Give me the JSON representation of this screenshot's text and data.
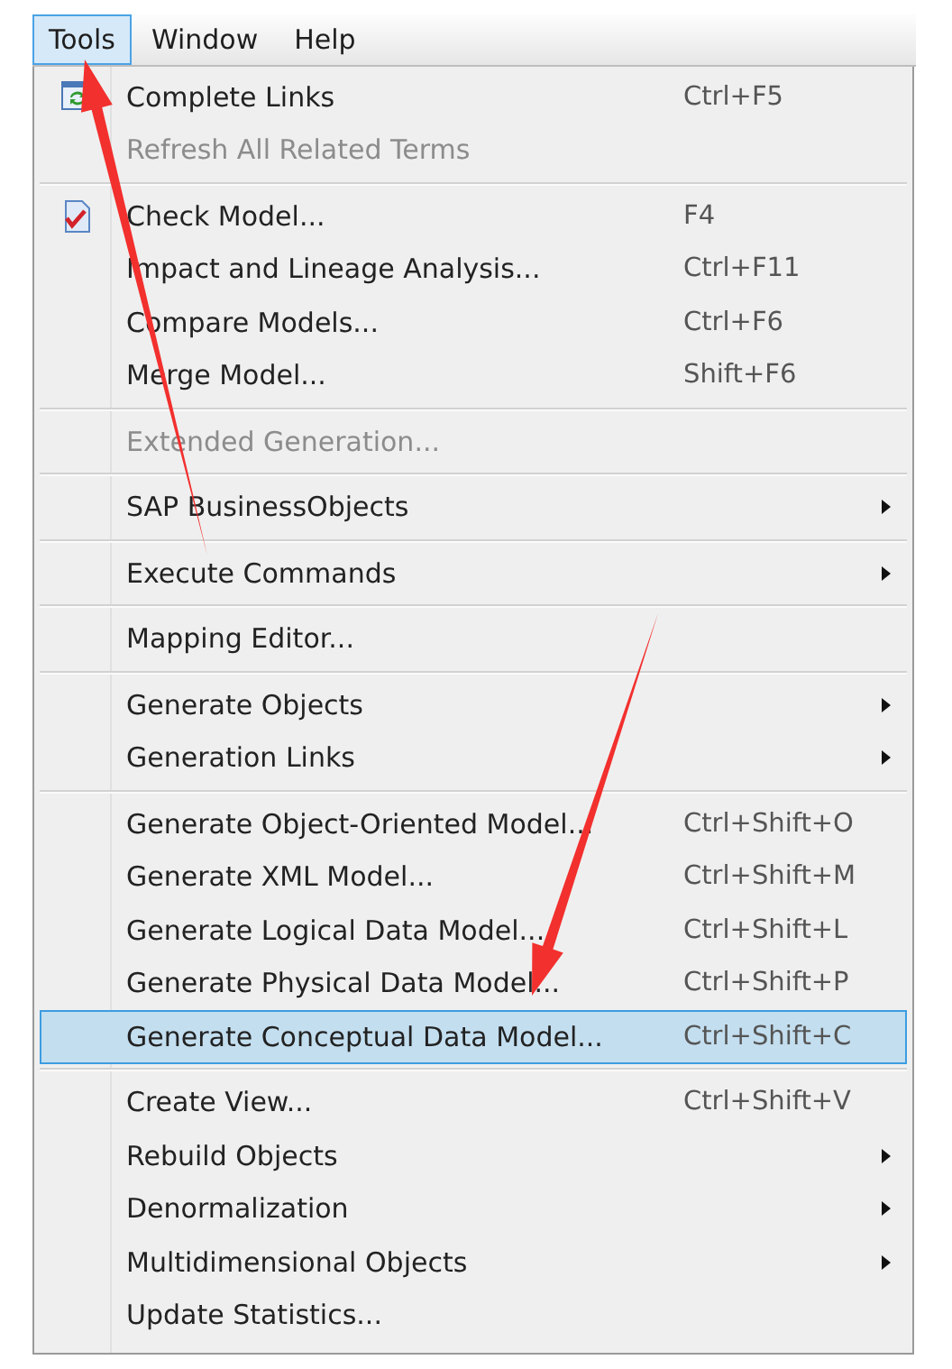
{
  "menu_bar": [
    {
      "label": "Tools",
      "selected": true
    },
    {
      "label": "Window",
      "selected": false
    },
    {
      "label": "Help",
      "selected": false
    }
  ],
  "menu": {
    "groups": [
      {
        "items": [
          {
            "label": "Complete Links",
            "shortcut": "Ctrl+F5",
            "disabled": false,
            "submenu": false,
            "selected": false
          },
          {
            "label": "Refresh All Related Terms",
            "disabled": true,
            "submenu": false,
            "selected": false
          }
        ]
      },
      {
        "items": [
          {
            "label": "Check Model...",
            "shortcut": "F4",
            "disabled": false,
            "submenu": false,
            "selected": false
          },
          {
            "label": "Impact and Lineage Analysis...",
            "shortcut": "Ctrl+F11",
            "disabled": false,
            "submenu": false,
            "selected": false
          },
          {
            "label": "Compare Models...",
            "shortcut": "Ctrl+F6",
            "disabled": false,
            "submenu": false,
            "selected": false
          },
          {
            "label": "Merge Model...",
            "shortcut": "Shift+F6",
            "disabled": false,
            "submenu": false,
            "selected": false
          }
        ]
      },
      {
        "items": [
          {
            "label": "Extended Generation...",
            "disabled": true,
            "submenu": false,
            "selected": false
          }
        ]
      },
      {
        "items": [
          {
            "label": "SAP BusinessObjects",
            "disabled": false,
            "submenu": true,
            "selected": false
          }
        ]
      },
      {
        "items": [
          {
            "label": "Execute Commands",
            "disabled": false,
            "submenu": true,
            "selected": false
          }
        ]
      },
      {
        "items": [
          {
            "label": "Mapping Editor...",
            "disabled": false,
            "submenu": false,
            "selected": false
          }
        ]
      },
      {
        "items": [
          {
            "label": "Generate Objects",
            "disabled": false,
            "submenu": true,
            "selected": false
          },
          {
            "label": "Generation Links",
            "disabled": false,
            "submenu": true,
            "selected": false
          }
        ]
      },
      {
        "items": [
          {
            "label": "Generate Object-Oriented Model...",
            "shortcut": "Ctrl+Shift+O",
            "disabled": false,
            "submenu": false,
            "selected": false
          },
          {
            "label": "Generate XML Model...",
            "shortcut": "Ctrl+Shift+M",
            "disabled": false,
            "submenu": false,
            "selected": false
          },
          {
            "label": "Generate Logical Data Model...",
            "shortcut": "Ctrl+Shift+L",
            "disabled": false,
            "submenu": false,
            "selected": false
          },
          {
            "label": "Generate Physical Data Model...",
            "shortcut": "Ctrl+Shift+P",
            "disabled": false,
            "submenu": false,
            "selected": false
          },
          {
            "label": "Generate Conceptual Data Model...",
            "shortcut": "Ctrl+Shift+C",
            "disabled": false,
            "submenu": false,
            "selected": true
          }
        ]
      },
      {
        "items": [
          {
            "label": "Create View...",
            "shortcut": "Ctrl+Shift+V",
            "disabled": false,
            "submenu": false,
            "selected": false
          },
          {
            "label": "Rebuild Objects",
            "disabled": false,
            "submenu": true,
            "selected": false
          },
          {
            "label": "Denormalization",
            "disabled": false,
            "submenu": true,
            "selected": false
          },
          {
            "label": "Multidimensional Objects",
            "disabled": false,
            "submenu": true,
            "selected": false
          },
          {
            "label": "Update Statistics...",
            "disabled": false,
            "submenu": false,
            "selected": false
          }
        ]
      }
    ]
  },
  "annotations": [
    {
      "kind": "arrow"
    },
    {
      "kind": "arrow"
    }
  ]
}
